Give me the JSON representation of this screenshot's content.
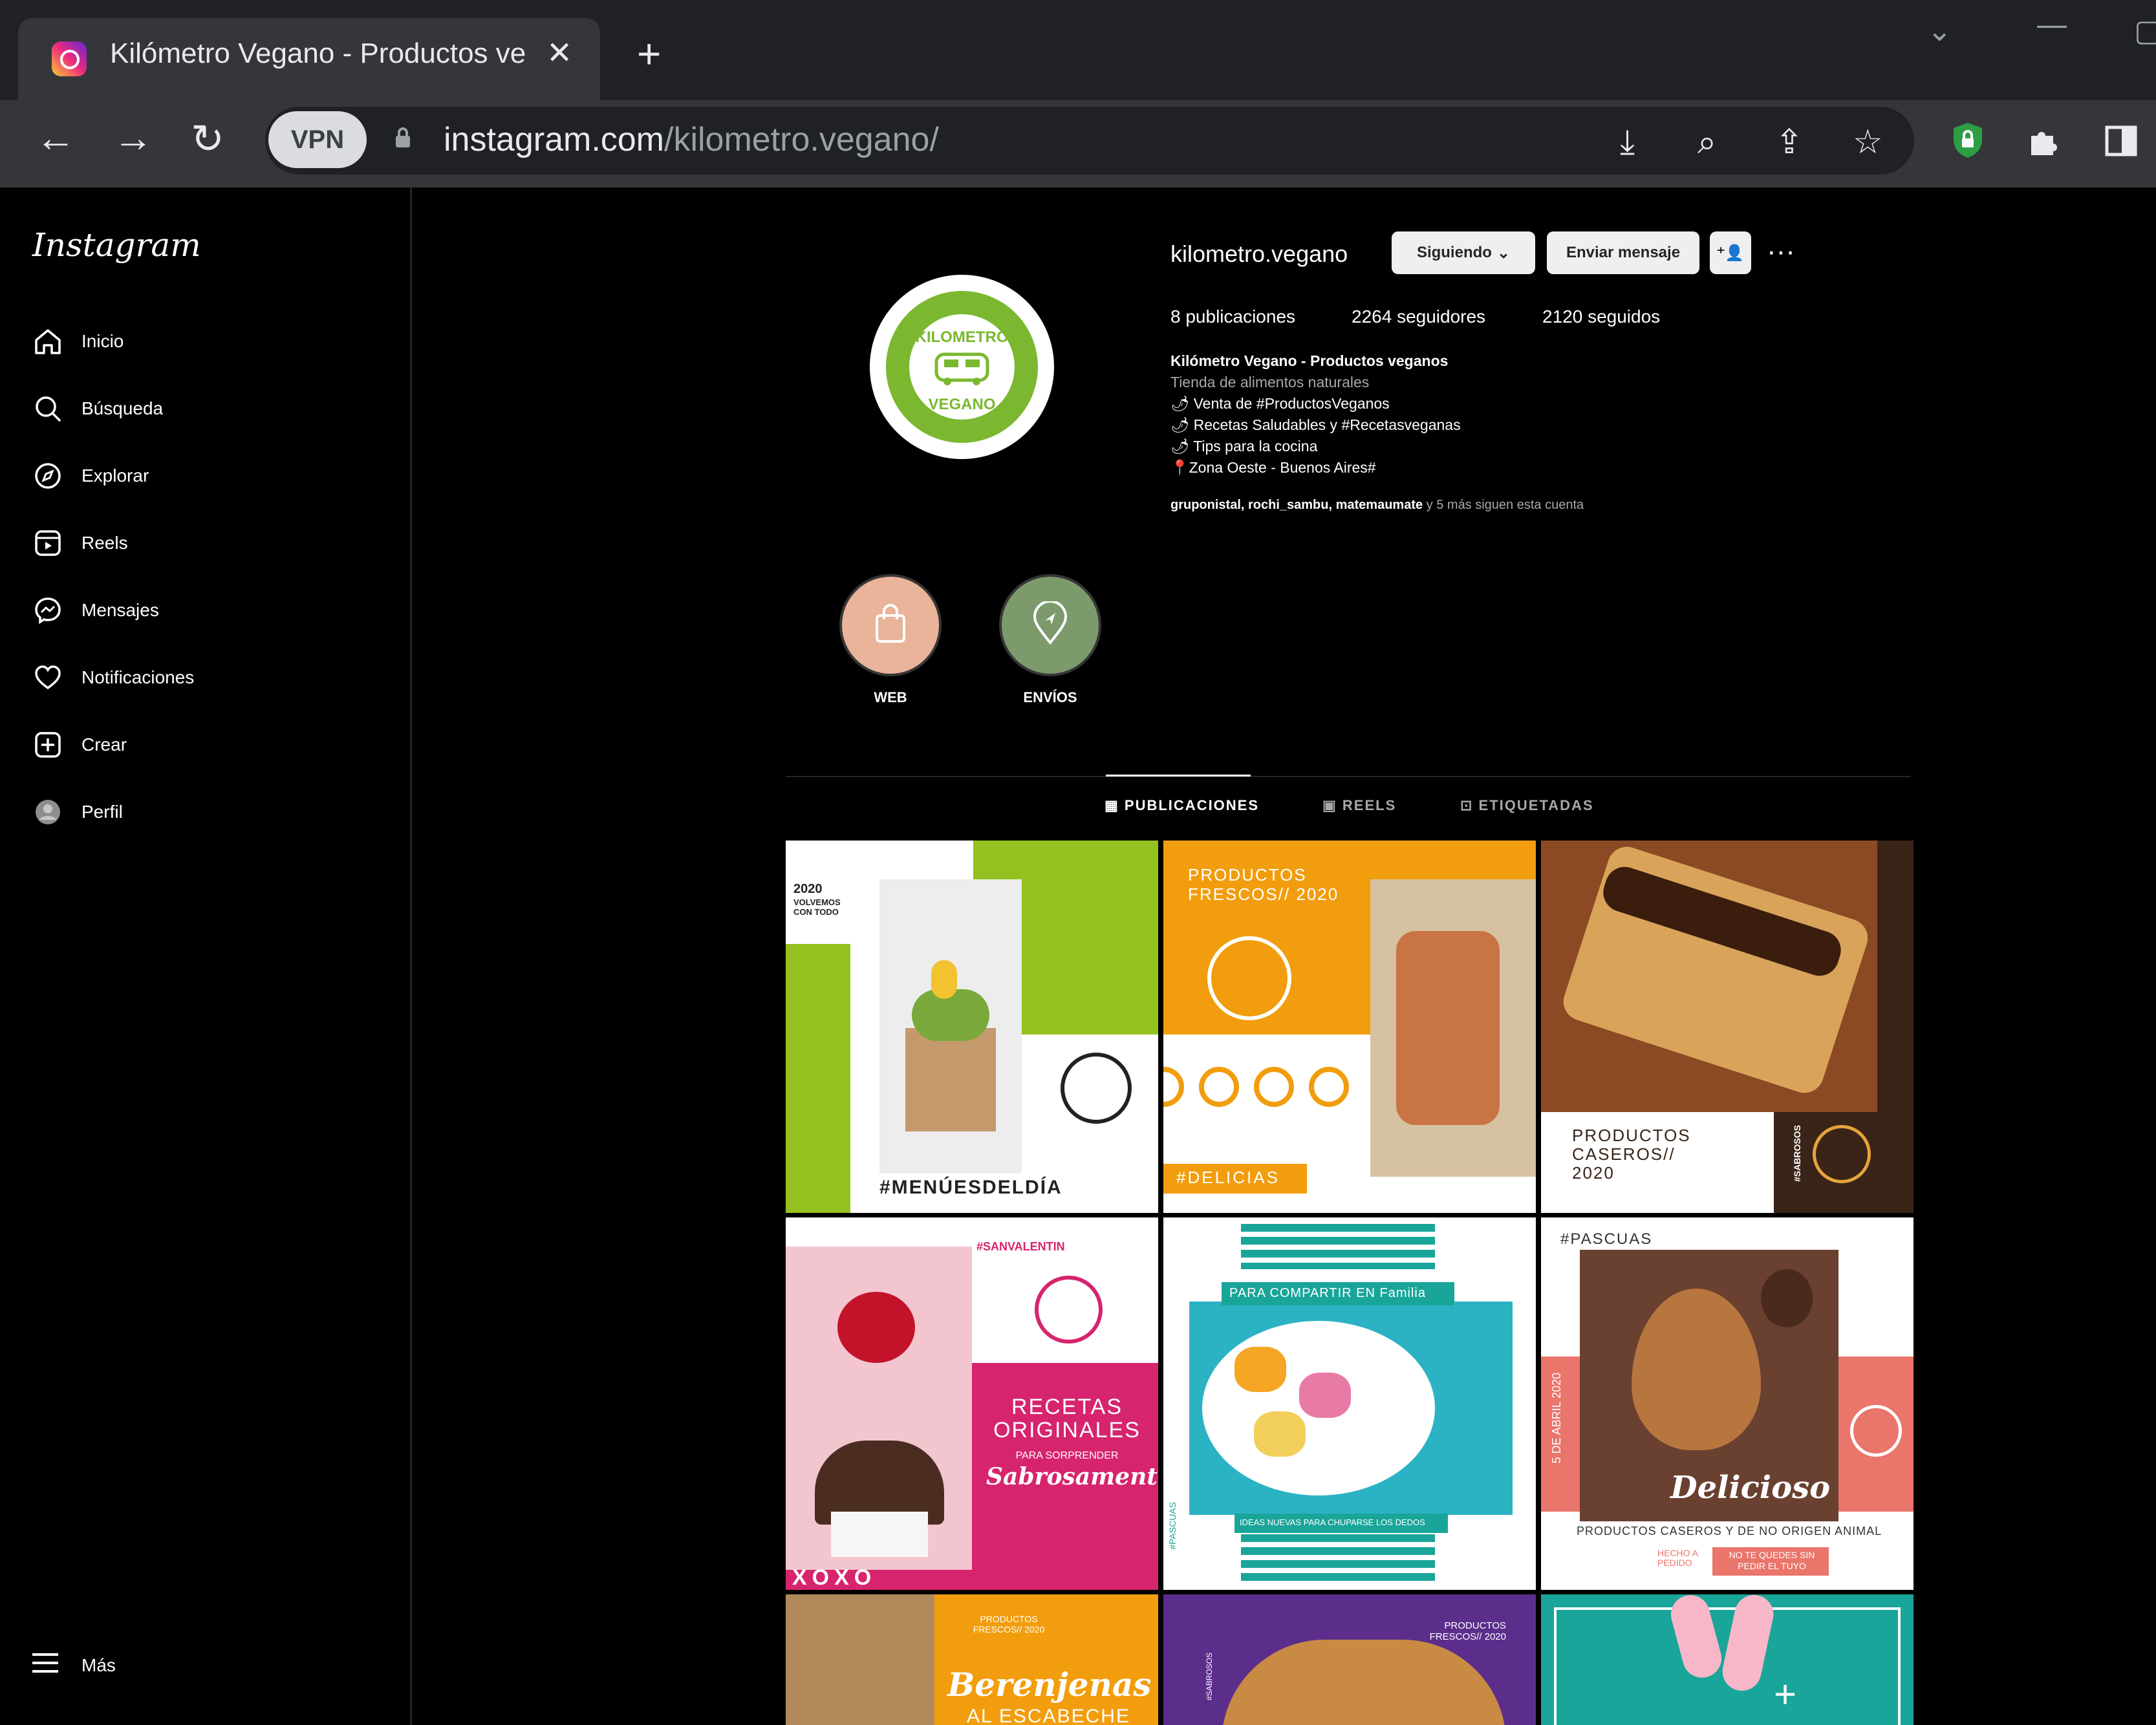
{
  "browser": {
    "tab_title": "Kilómetro Vegano - Productos ve",
    "url_host": "instagram.com",
    "url_path": "/kilometro.vegano/",
    "vpn_label": "VPN"
  },
  "sidebar": {
    "logo": "Instagram",
    "items": [
      {
        "label": "Inicio",
        "icon": "home-icon"
      },
      {
        "label": "Búsqueda",
        "icon": "search-icon"
      },
      {
        "label": "Explorar",
        "icon": "compass-icon"
      },
      {
        "label": "Reels",
        "icon": "reels-icon"
      },
      {
        "label": "Mensajes",
        "icon": "messenger-icon"
      },
      {
        "label": "Notificaciones",
        "icon": "heart-icon"
      },
      {
        "label": "Crear",
        "icon": "plus-square-icon"
      },
      {
        "label": "Perfil",
        "icon": "avatar"
      }
    ],
    "more": "Más"
  },
  "profile": {
    "username": "kilometro.vegano",
    "following_btn": "Siguiendo",
    "message_btn": "Enviar mensaje",
    "posts": "8 publicaciones",
    "followers": "2264 seguidores",
    "following": "2120 seguidos",
    "bio_name": "Kilómetro Vegano - Productos veganos",
    "bio_category": "Tienda de alimentos naturales",
    "bio_lines": [
      "🌶 Venta de #ProductosVeganos",
      "🌶 Recetas Saludables y #Recetasveganas",
      "🌶 Tips para la cocina",
      "📍Zona Oeste - Buenos Aires#"
    ],
    "followed_by_names": "gruponistal, rochi_sambu, matemaumate",
    "followed_by_rest": " y 5 más siguen esta cuenta",
    "avatar_text_top": "KILOMETRO",
    "avatar_text_bottom": "VEGANO"
  },
  "highlights": [
    {
      "label": "WEB",
      "color": "#e9b49a",
      "icon": "shopping-bag-icon"
    },
    {
      "label": "ENVÍOS",
      "color": "#7c9a6c",
      "icon": "location-pin-icon"
    }
  ],
  "tabs": [
    "PUBLICACIONES",
    "REELS",
    "ETIQUETADAS"
  ],
  "posts": [
    {
      "text1": "2020",
      "text2": "VOLVEMOS CON TODO",
      "text3": "#MENÚESDELDÍA"
    },
    {
      "text1": "PRODUCTOS FRESCOS// 2020",
      "text2": "#DELICIAS"
    },
    {
      "text1": "PRODUCTOS CASEROS// 2020",
      "text2": "#SABROSOS"
    },
    {
      "text1": "#SANVALENTIN",
      "text2": "RECETAS ORIGINALES",
      "text3": "PARA SORPRENDER",
      "text4": "Sabrosamente",
      "text5": "XOXO"
    },
    {
      "text1": "PARA COMPARTIR EN Familia",
      "text2": "IDEAS NUEVAS PARA CHUPARSE LOS DEDOS",
      "text3": "#PASCUAS"
    },
    {
      "text1": "#PASCUAS",
      "text2": "Delicioso",
      "text3": "PRODUCTOS CASEROS Y DE NO ORIGEN ANIMAL",
      "text4": "5 DE ABRIL 2020",
      "text5": "HECHO A PEDIDO",
      "text6": "NO TE QUEDES SIN PEDIR EL TUYO"
    },
    {
      "text1": "PRODUCTOS FRESCOS// 2020",
      "text2": "Berenjenas",
      "text3": "AL ESCABECHE"
    },
    {
      "text1": "PRODUCTOS FRESCOS// 2020",
      "text2": "#SABROSOS"
    },
    {}
  ]
}
